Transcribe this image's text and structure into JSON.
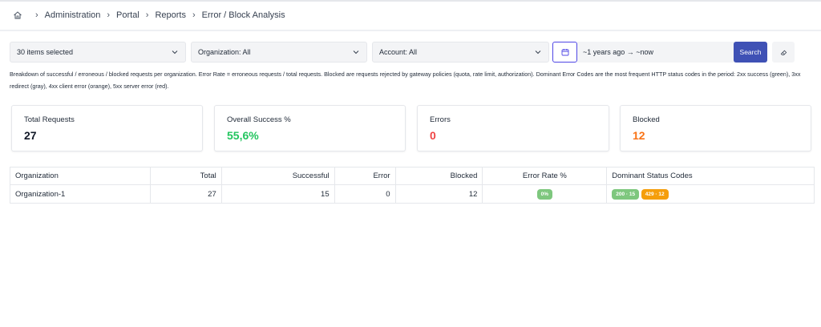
{
  "breadcrumb": [
    "Administration",
    "Portal",
    "Reports",
    "Error / Block Analysis"
  ],
  "filters": {
    "items": "30 items selected",
    "organization": "Organization: All",
    "account": "Account: All",
    "date_range": "~1 years ago → ~now",
    "search_label": "Search"
  },
  "description": "Breakdown of successful / erroneous / blocked requests per organization. Error Rate = erroneous requests / total requests. Blocked are requests rejected by gateway policies (quota, rate limit, authorization). Dominant Error Codes are the most frequent HTTP status codes in the period: 2xx success (green), 3xx redirect (gray), 4xx client error (orange), 5xx server error (red).",
  "cards": [
    {
      "label": "Total Requests",
      "value": "27",
      "color": "#111827"
    },
    {
      "label": "Overall Success %",
      "value": "55,6%",
      "color": "#22c55e"
    },
    {
      "label": "Errors",
      "value": "0",
      "color": "#ef4444"
    },
    {
      "label": "Blocked",
      "value": "12",
      "color": "#f97316"
    }
  ],
  "table": {
    "headers": [
      "Organization",
      "Total",
      "Successful",
      "Error",
      "Blocked",
      "Error Rate %",
      "Dominant Status Codes"
    ],
    "rows": [
      {
        "organization": "Organization-1",
        "total": "27",
        "successful": "15",
        "error": "0",
        "blocked": "12",
        "error_rate": "0%",
        "codes": [
          "200 · 15",
          "429 · 12"
        ]
      }
    ]
  },
  "colors": {
    "accent": "#3f51b5",
    "success_badge": "#7ec77e",
    "warning_badge": "#f59e0b"
  }
}
